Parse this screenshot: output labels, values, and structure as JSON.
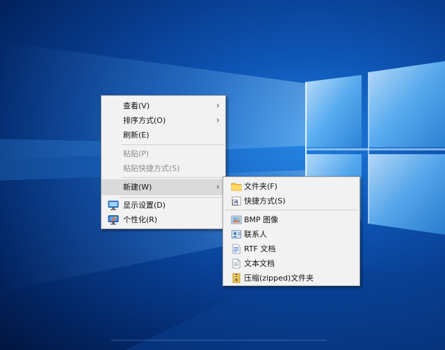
{
  "main_menu": {
    "items": [
      {
        "label": "查看(V)"
      },
      {
        "label": "排序方式(O)"
      },
      {
        "label": "刷新(E)"
      },
      {
        "label": "粘贴(P)"
      },
      {
        "label": "粘贴快捷方式(S)"
      },
      {
        "label": "新建(W)"
      },
      {
        "label": "显示设置(D)",
        "icon": "display-settings-icon"
      },
      {
        "label": "个性化(R)",
        "icon": "personalize-icon"
      }
    ],
    "arrow": "›"
  },
  "sub_menu": {
    "items": [
      {
        "label": "文件夹(F)",
        "icon": "folder-icon"
      },
      {
        "label": "快捷方式(S)",
        "icon": "shortcut-icon"
      },
      {
        "label": "BMP 图像",
        "icon": "bmp-image-icon"
      },
      {
        "label": "联系人",
        "icon": "contact-icon"
      },
      {
        "label": "RTF 文档",
        "icon": "rtf-document-icon"
      },
      {
        "label": "文本文档",
        "icon": "text-document-icon"
      },
      {
        "label": "压缩(zipped)文件夹",
        "icon": "zip-folder-icon"
      }
    ]
  },
  "colors": {
    "menu_bg": "#f2f2f2",
    "highlight": "#dadada",
    "disabled_text": "#8c8c8c",
    "desktop_blue": "#0e56b6"
  }
}
